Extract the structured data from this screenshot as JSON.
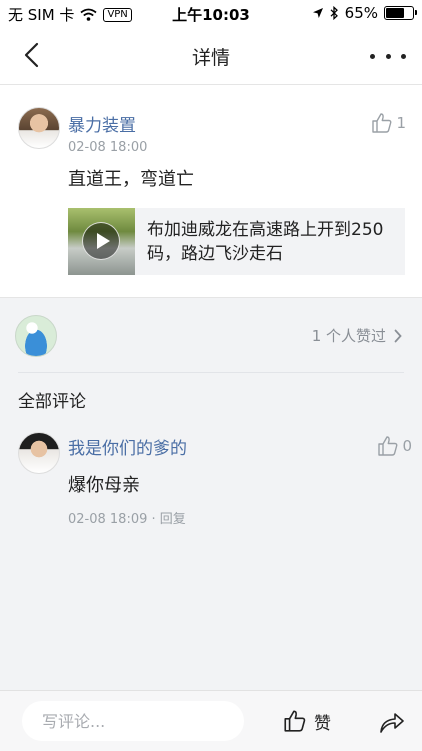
{
  "status_bar": {
    "carrier": "无 SIM 卡",
    "vpn": "VPN",
    "time": "上午10:03",
    "battery_percent": "65%",
    "battery_level": 0.65
  },
  "nav": {
    "title": "详情"
  },
  "post": {
    "username": "暴力装置",
    "timestamp": "02-08 18:00",
    "like_count": "1",
    "content": "直道王，弯道亡",
    "link": {
      "text": "布加迪威龙在高速路上开到250码，路边飞沙走石"
    }
  },
  "likes": {
    "summary": "1 个人赞过"
  },
  "comments_section": {
    "title": "全部评论",
    "items": [
      {
        "username": "我是你们的爹的",
        "like_count": "0",
        "content": "爆你母亲",
        "timestamp": "02-08 18:09",
        "separator": "·",
        "reply_label": "回复"
      }
    ]
  },
  "bottom_bar": {
    "input_placeholder": "写评论...",
    "like_label": "赞"
  }
}
